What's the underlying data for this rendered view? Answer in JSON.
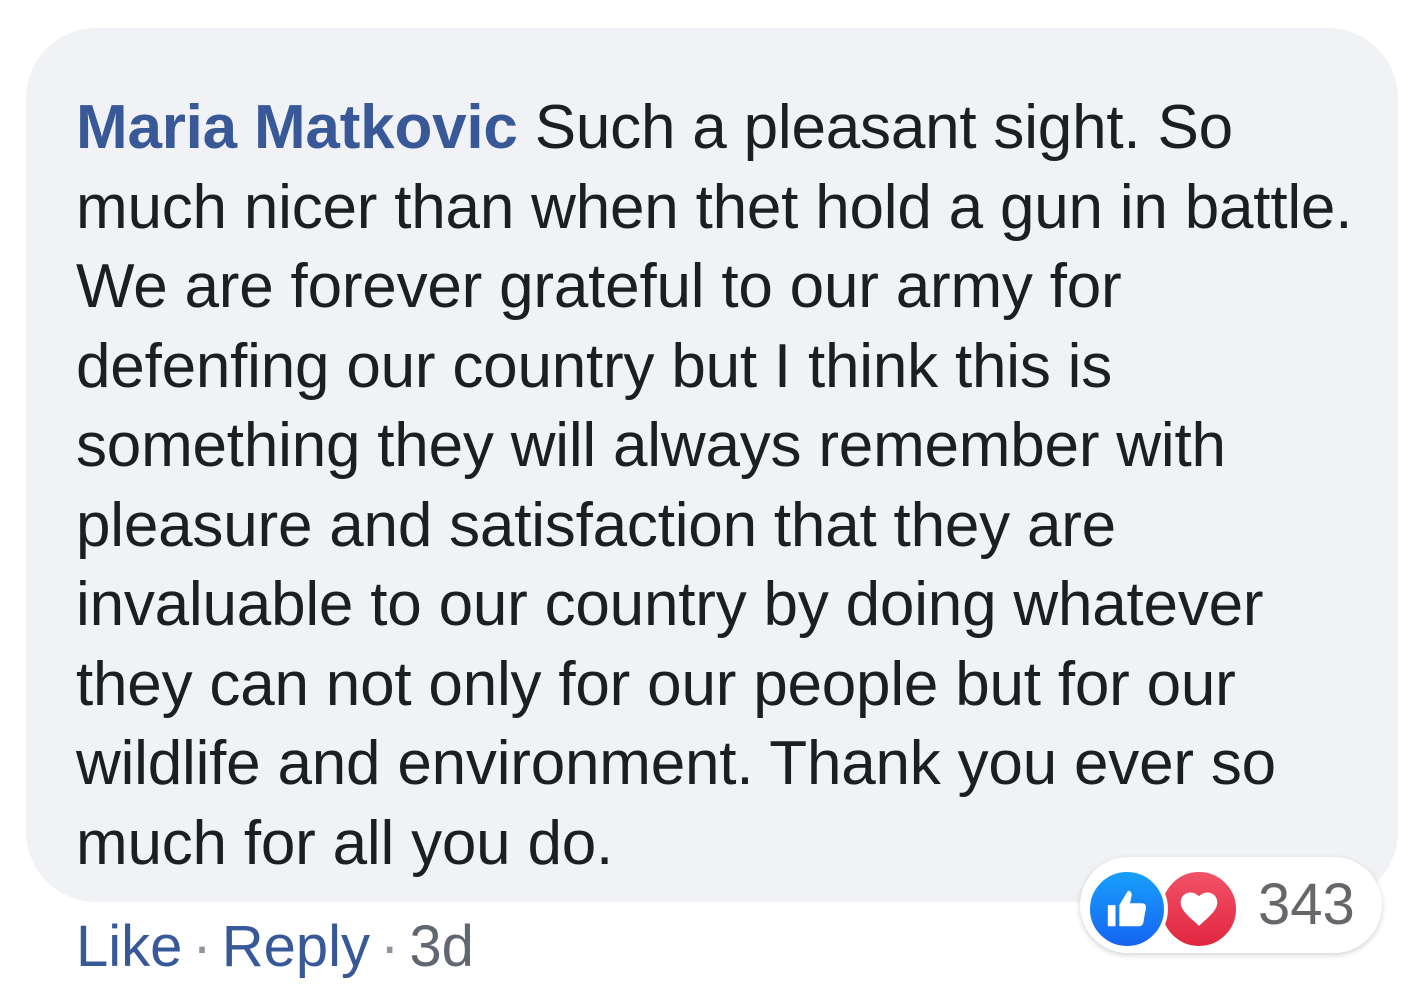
{
  "comment": {
    "author": "Maria Matkovic",
    "text": "Such a pleasant sight. So much nicer than when thet hold a gun in battle. We are forever grateful to our army for defenfing our country but I think this is something they will always remember with pleasure and satisfaction that they are invaluable to our country by doing whatever they can not only for our people but for our wildlife and environment. Thank you ever so much for all you do."
  },
  "actions": {
    "like_label": "Like",
    "separator": "·",
    "reply_label": "Reply",
    "timestamp": "3d"
  },
  "reactions": {
    "icons": [
      "like-icon",
      "love-icon"
    ],
    "count": "343"
  },
  "colors": {
    "bubble_background": "#f0f2f5",
    "author_link": "#385898",
    "text": "#1c1e21",
    "like_blue": "#1877f2",
    "love_red": "#e9334d"
  }
}
